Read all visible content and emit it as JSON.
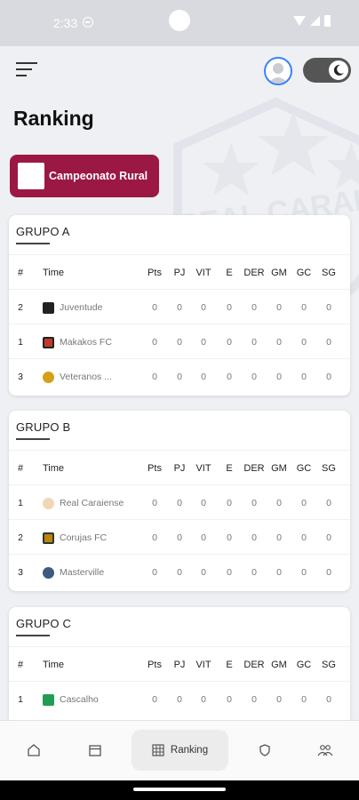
{
  "status": {
    "time": "2:33"
  },
  "header": {
    "title": "Ranking"
  },
  "chip": {
    "label": "Campeonato Rural"
  },
  "columns": [
    "#",
    "Time",
    "Pts",
    "PJ",
    "VIT",
    "E",
    "DER",
    "GM",
    "GC",
    "SG"
  ],
  "groups": [
    {
      "title": "GRUPO A",
      "rows": [
        {
          "pos": "2",
          "team": "Juventude",
          "vals": [
            "0",
            "0",
            "0",
            "0",
            "0",
            "0",
            "0",
            "0"
          ]
        },
        {
          "pos": "1",
          "team": "Makakos FC",
          "vals": [
            "0",
            "0",
            "0",
            "0",
            "0",
            "0",
            "0",
            "0"
          ]
        },
        {
          "pos": "3",
          "team": "Veteranos ...",
          "vals": [
            "0",
            "0",
            "0",
            "0",
            "0",
            "0",
            "0",
            "0"
          ]
        }
      ]
    },
    {
      "title": "GRUPO B",
      "rows": [
        {
          "pos": "1",
          "team": "Real Caraiense",
          "vals": [
            "0",
            "0",
            "0",
            "0",
            "0",
            "0",
            "0",
            "0"
          ]
        },
        {
          "pos": "2",
          "team": "Corujas FC",
          "vals": [
            "0",
            "0",
            "0",
            "0",
            "0",
            "0",
            "0",
            "0"
          ]
        },
        {
          "pos": "3",
          "team": "Masterville",
          "vals": [
            "0",
            "0",
            "0",
            "0",
            "0",
            "0",
            "0",
            "0"
          ]
        }
      ]
    },
    {
      "title": "GRUPO C",
      "rows": [
        {
          "pos": "1",
          "team": "Cascalho",
          "vals": [
            "0",
            "0",
            "0",
            "0",
            "0",
            "0",
            "0",
            "0"
          ]
        }
      ]
    }
  ],
  "nav": {
    "active_label": "Ranking"
  },
  "background_logo_text": "REAL CARAIENSE",
  "colors": {
    "accent": "#9c1844",
    "toggle": "#555555"
  }
}
